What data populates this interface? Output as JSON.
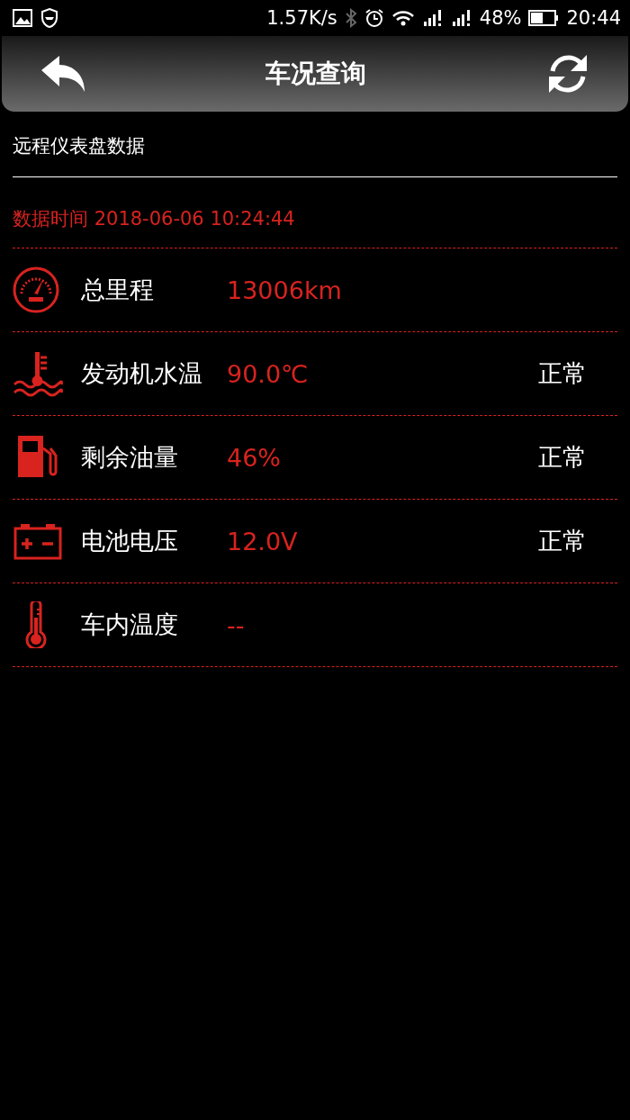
{
  "status_bar": {
    "speed": "1.57K/s",
    "battery": "48%",
    "time": "20:44"
  },
  "header": {
    "title": "车况查询"
  },
  "section_title": "远程仪表盘数据",
  "data_time": "数据时间 2018-06-06 10:24:44",
  "items": [
    {
      "kind": "odometer",
      "label": "总里程",
      "value": "13006km"
    },
    {
      "kind": "coolant",
      "label": "发动机水温",
      "value": "90.0℃",
      "status": "正常"
    },
    {
      "kind": "fuel",
      "label": "剩余油量",
      "value": "46%",
      "status": "正常"
    },
    {
      "kind": "battery",
      "label": "电池电压",
      "value": "12.0V",
      "status": "正常"
    },
    {
      "kind": "thermometer",
      "label": "车内温度",
      "value": "--"
    }
  ]
}
